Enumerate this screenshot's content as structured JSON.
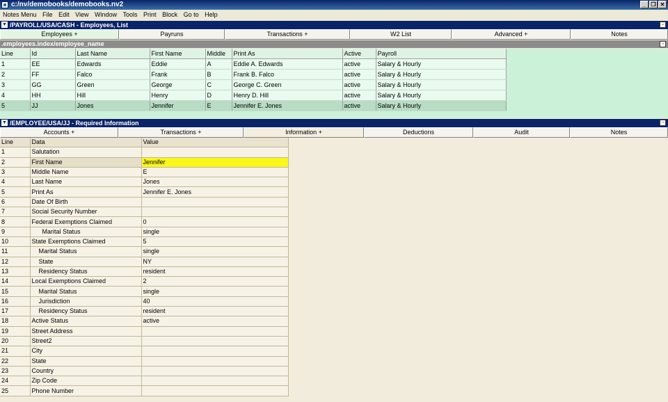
{
  "window": {
    "title": "c:/nv/demobooks/demobooks.nv2"
  },
  "menu": [
    "Notes Menu",
    "File",
    "Edit",
    "View",
    "Window",
    "Tools",
    "Print",
    "Block",
    "Go to",
    "Help"
  ],
  "panel1": {
    "title": "/PAYROLL/USA/CASH - Employees, List",
    "tabs": [
      "Employees   +",
      "Payruns",
      "Transactions   +",
      "W2 List",
      "Advanced   +",
      "Notes"
    ],
    "subtitle": ".employees.index/employee_name",
    "columns": [
      "Line",
      "Id",
      "Last Name",
      "First Name",
      "Middle",
      "Print As",
      "Active",
      "Payroll"
    ],
    "rows": [
      [
        "1",
        "EE",
        "Edwards",
        "Eddie",
        "A",
        "Eddie A. Edwards",
        "active",
        "Salary & Hourly"
      ],
      [
        "2",
        "FF",
        "Falco",
        "Frank",
        "B",
        "Frank B. Falco",
        "active",
        "Salary & Hourly"
      ],
      [
        "3",
        "GG",
        "Green",
        "George",
        "C",
        "George C. Green",
        "active",
        "Salary & Hourly"
      ],
      [
        "4",
        "HH",
        "Hill",
        "Henry",
        "D",
        "Henry D. Hill",
        "active",
        "Salary & Hourly"
      ],
      [
        "5",
        "JJ",
        "Jones",
        "Jennifer",
        "E",
        "Jennifer E. Jones",
        "active",
        "Salary & Hourly"
      ]
    ]
  },
  "panel2": {
    "title": "/EMPLOYEE/USA/JJ - Required Information",
    "tabs": [
      "Accounts   +",
      "Transactions   +",
      "Information   +",
      "Deductions",
      "Audit",
      "Notes"
    ],
    "columns": [
      "Line",
      "Data",
      "Value"
    ],
    "rows": [
      [
        "1",
        "Salutation",
        ""
      ],
      [
        "2",
        "First Name",
        "Jennifer"
      ],
      [
        "3",
        "Middle Name",
        "E"
      ],
      [
        "4",
        "Last Name",
        "Jones"
      ],
      [
        "5",
        "Print As",
        "Jennifer E. Jones"
      ],
      [
        "6",
        "Date Of Birth",
        ""
      ],
      [
        "7",
        "Social Security Number",
        ""
      ],
      [
        "8",
        "Federal Exemptions Claimed",
        "0"
      ],
      [
        "9",
        "      Marital Status",
        "single"
      ],
      [
        "10",
        "State Exemptions Claimed",
        "5"
      ],
      [
        "11",
        "    Marital Status",
        "single"
      ],
      [
        "12",
        "    State",
        "NY"
      ],
      [
        "13",
        "    Residency Status",
        "resident"
      ],
      [
        "14",
        "Local Exemptions Claimed",
        "2"
      ],
      [
        "15",
        "    Marital Status",
        "single"
      ],
      [
        "16",
        "    Jurisdiction",
        "40"
      ],
      [
        "17",
        "    Residency Status",
        "resident"
      ],
      [
        "18",
        "Active Status",
        "active"
      ],
      [
        "19",
        "Street Address",
        ""
      ],
      [
        "20",
        "Street2",
        ""
      ],
      [
        "21",
        "City",
        ""
      ],
      [
        "22",
        "State",
        ""
      ],
      [
        "23",
        "Country",
        ""
      ],
      [
        "24",
        "Zip Code",
        ""
      ],
      [
        "25",
        "Phone Number",
        ""
      ]
    ]
  },
  "colors": {
    "titlebar": "#0a246a",
    "highlight": "#f2ee1c",
    "grid1_bg": "#ccf1d9",
    "grid2_bg": "#f1ecdc"
  }
}
